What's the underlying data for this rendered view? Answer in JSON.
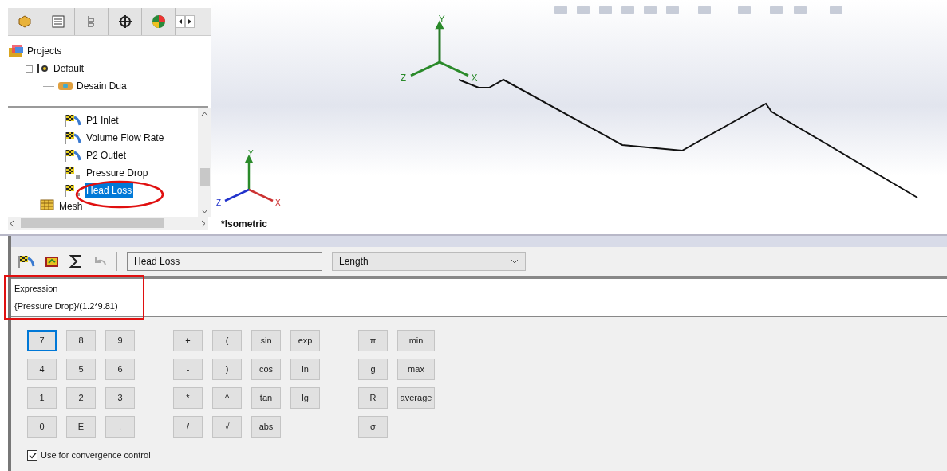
{
  "panel_tabs": [
    {
      "kind": "part",
      "selected": false
    },
    {
      "kind": "list",
      "selected": false
    },
    {
      "kind": "config",
      "selected": false
    },
    {
      "kind": "target",
      "selected": false
    },
    {
      "kind": "appearance",
      "selected": false
    }
  ],
  "project_tree": [
    {
      "label": "Projects",
      "kind": "projects",
      "children": [
        {
          "label": "Default",
          "kind": "config",
          "expanded": true,
          "children": [
            {
              "label": "Desain Dua",
              "kind": "design"
            }
          ]
        }
      ]
    }
  ],
  "analysis_tree": [
    {
      "label": "P1 Inlet",
      "kind": "goal",
      "selected": false
    },
    {
      "label": "Volume Flow Rate",
      "kind": "goal",
      "selected": false
    },
    {
      "label": "P2 Outlet",
      "kind": "goal",
      "selected": false
    },
    {
      "label": "Pressure Drop",
      "kind": "equation",
      "selected": false
    },
    {
      "label": "Head Loss",
      "kind": "equation",
      "selected": true
    },
    {
      "label": "Mesh",
      "kind": "mesh",
      "selected": false
    }
  ],
  "viewport": {
    "view_label": "*Isometric",
    "triads": [
      {
        "y": "Y",
        "x": "X",
        "z": "Z"
      },
      {
        "y": "Y",
        "x": "X",
        "z": "Z"
      }
    ]
  },
  "goal_editor": {
    "name": "Head Loss",
    "dimension": "Length",
    "expression_label": "Expression",
    "expression": "{Pressure Drop}/(1.2*9.81)",
    "keypad": [
      [
        [
          "7",
          "8",
          "9"
        ],
        [
          "4",
          "5",
          "6"
        ],
        [
          "1",
          "2",
          "3"
        ],
        [
          "0",
          "E",
          "."
        ]
      ],
      [
        [
          "+",
          "(",
          "sin",
          "exp"
        ],
        [
          "-",
          ")",
          "cos",
          "ln"
        ],
        [
          "*",
          "^",
          "tan",
          "lg"
        ],
        [
          "/",
          "√",
          "abs"
        ]
      ],
      [
        [
          "π",
          "min"
        ],
        [
          "g",
          "max"
        ],
        [
          "R",
          "average"
        ],
        [
          "σ"
        ]
      ]
    ],
    "convergence": {
      "label": "Use for convergence control",
      "checked": true
    }
  }
}
